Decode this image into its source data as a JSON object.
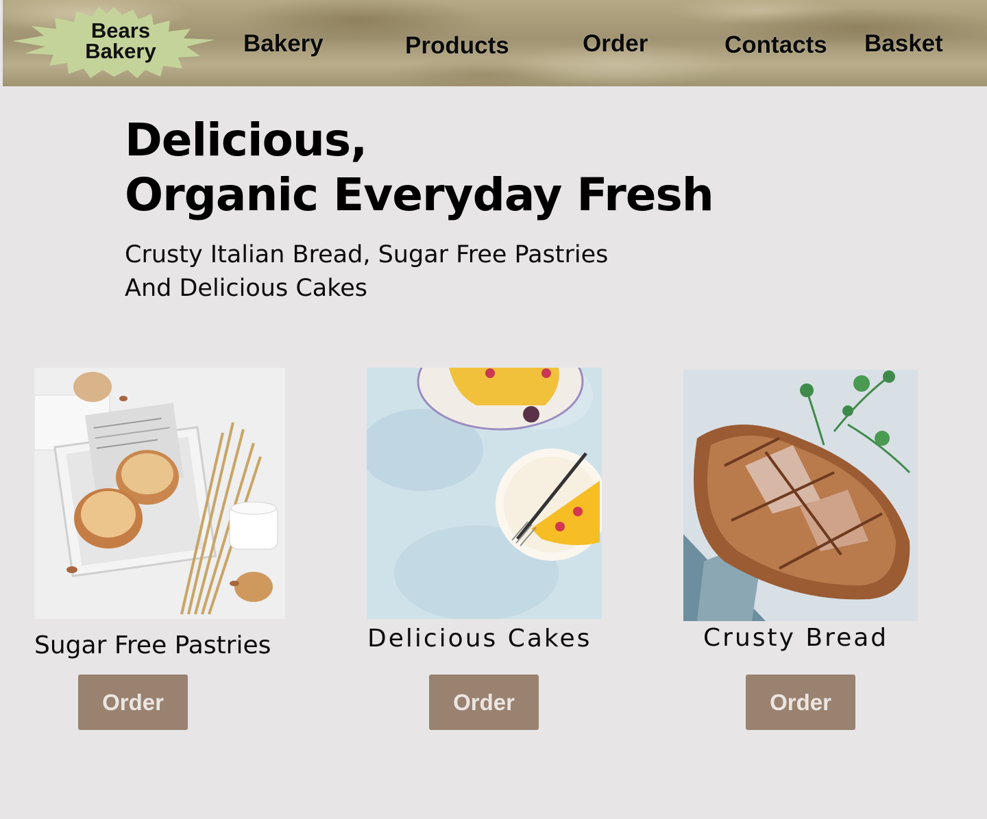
{
  "logo": {
    "line1": "Bears",
    "line2": "Bakery"
  },
  "nav": {
    "bakery": "Bakery",
    "products": "Products",
    "order": "Order",
    "contacts": "Contacts",
    "basket": "Basket"
  },
  "hero": {
    "title_line1": "Delicious,",
    "title_line2": "Organic Everyday Fresh",
    "subtitle_line1": "Crusty Italian Bread, Sugar Free Pastries",
    "subtitle_line2": "And Delicious Cakes"
  },
  "products": [
    {
      "title": "Sugar Free Pastries",
      "button": "Order"
    },
    {
      "title": "Delicious Cakes",
      "button": "Order"
    },
    {
      "title": "Crusty Bread",
      "button": "Order"
    }
  ],
  "colors": {
    "page_bg": "#e7e5e6",
    "logo_badge": "#c4d39a",
    "button_bg": "#9a8271",
    "button_text": "#ece6e1"
  }
}
